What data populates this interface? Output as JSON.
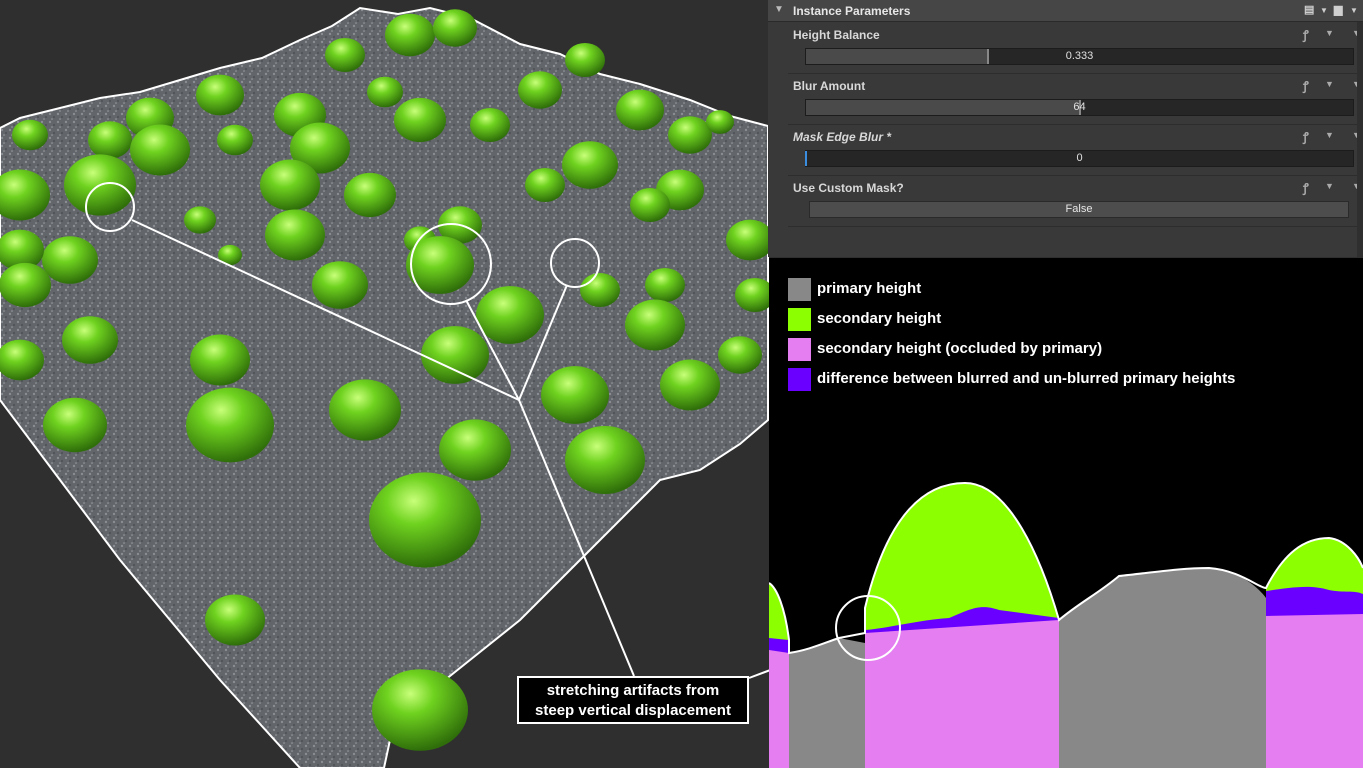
{
  "panel": {
    "title": "Instance Parameters",
    "params": [
      {
        "label": "Height Balance",
        "value": "0.333",
        "fraction": 0.333
      },
      {
        "label": "Blur Amount",
        "value": "64",
        "fraction": 0.5
      },
      {
        "label": "Mask Edge Blur *",
        "value": "0",
        "fraction": 0.0
      },
      {
        "label": "Use Custom Mask?",
        "value": "False"
      }
    ]
  },
  "legend": {
    "items": [
      {
        "label": "primary height",
        "color": "#888888"
      },
      {
        "label": "secondary height",
        "color": "#8cff00"
      },
      {
        "label": "secondary height (occluded by primary)",
        "color": "#e57ef0"
      },
      {
        "label": "difference between blurred and un-blurred primary heights",
        "color": "#6a00ff"
      }
    ]
  },
  "callout": {
    "line1": "stretching artifacts from",
    "line2": "steep vertical displacement"
  },
  "colors": {
    "moss": "#6fc81f",
    "ground": "#6a6e73",
    "panel_bg": "#393939"
  }
}
